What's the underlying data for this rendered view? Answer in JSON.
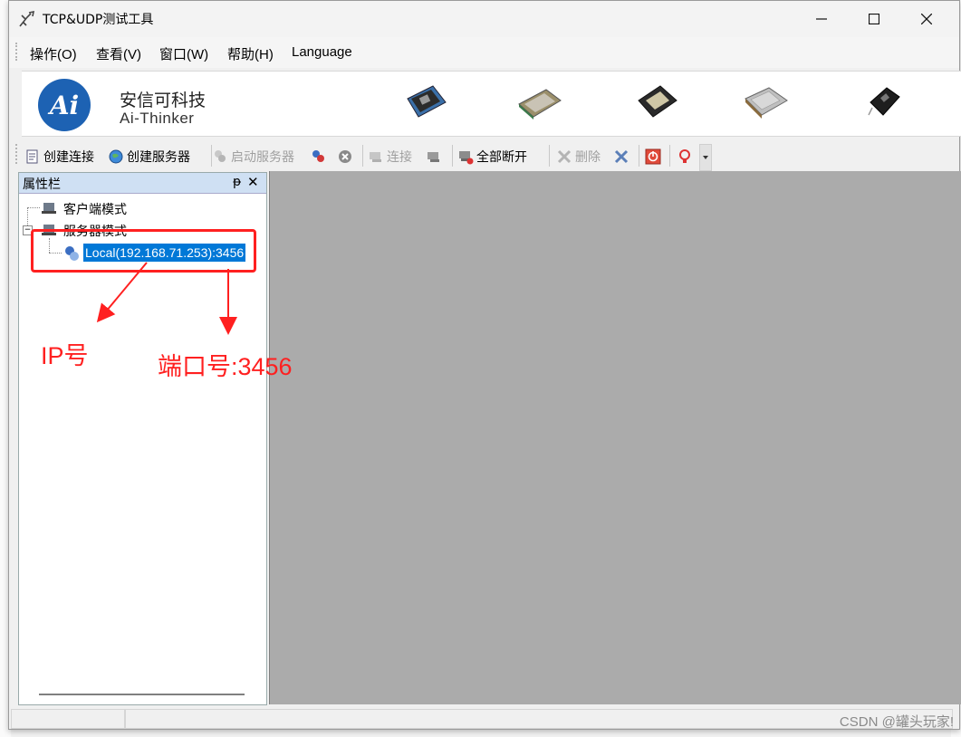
{
  "window": {
    "title": "TCP&UDP测试工具",
    "minimize_glyph": "—",
    "maximize_glyph": "☐",
    "close_glyph": "✕"
  },
  "menu": {
    "items": [
      "操作(O)",
      "查看(V)",
      "窗口(W)",
      "帮助(H)",
      "Language"
    ]
  },
  "banner": {
    "logo_text": "Ai",
    "company_cn": "安信可科技",
    "company_en": "Ai-Thinker"
  },
  "toolbar": {
    "create_connection": "创建连接",
    "create_server": "创建服务器",
    "start_server": "启动服务器",
    "connect": "连接",
    "disconnect_all": "全部断开",
    "delete": "删除"
  },
  "panel": {
    "title": "属性栏",
    "pin_glyph": "ᵽ",
    "close_glyph": "✕",
    "tree": {
      "client_mode": "客户端模式",
      "server_mode": "服务器模式",
      "server_entry": "Local(192.168.71.253):3456"
    }
  },
  "annotations": {
    "ip_label": "IP号",
    "port_label": "端口号:3456",
    "color": "#ff2020"
  },
  "status": {
    "watermark": "CSDN @罐头玩家!"
  },
  "colors": {
    "selection": "#0078d7",
    "logo_blue": "#1d62b3",
    "panel_header": "#cfe0f3",
    "content_bg": "#ababab"
  }
}
